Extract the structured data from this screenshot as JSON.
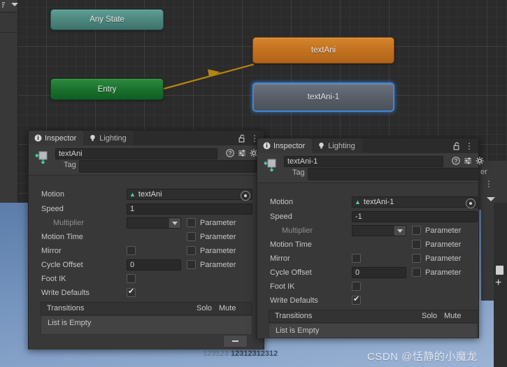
{
  "app": {
    "name": "Unity Editor",
    "context": "Animator window with two Inspector panels"
  },
  "graph": {
    "nodes": [
      {
        "label": "Any State",
        "type": "any-state",
        "color": "#4b857c"
      },
      {
        "label": "Entry",
        "type": "entry",
        "color": "#19702c"
      },
      {
        "label": "textAni",
        "type": "state-default",
        "color": "#c2711f"
      },
      {
        "label": "textAni-1",
        "type": "state-selected",
        "color": "#585f6a",
        "selection_color": "#3f86d8"
      }
    ],
    "transitions": [
      {
        "from": "Entry",
        "to": "textAni",
        "color": "#b5860f"
      }
    ]
  },
  "background_panel": {
    "tab_label_clipped": "oller",
    "kebab": "⋮"
  },
  "desktop": {
    "faint_text": "123123",
    "text": "12312312312",
    "watermark": "CSDN @恬静的小魔龙"
  },
  "inspector_left": {
    "tabs": [
      {
        "label": "Inspector",
        "icon": "info-icon",
        "active": true
      },
      {
        "label": "Lighting",
        "icon": "lightbulb-icon",
        "active": false
      }
    ],
    "lock_icon": "lock-open-icon",
    "menu_icon": "⋮",
    "object_name": "textAni",
    "tag_label": "Tag",
    "tag_value": "",
    "header_icons": [
      "help-icon",
      "preset-icon",
      "gear-icon"
    ],
    "fields": {
      "motion_label": "Motion",
      "motion_value": "textAni",
      "speed_label": "Speed",
      "speed_value": "1",
      "multiplier_label": "Multiplier",
      "multiplier_value": "",
      "multiplier_parameter_label": "Parameter",
      "motion_time_label": "Motion Time",
      "motion_time_parameter_label": "Parameter",
      "mirror_label": "Mirror",
      "mirror_parameter_label": "Parameter",
      "cycle_offset_label": "Cycle Offset",
      "cycle_offset_value": "0",
      "cycle_offset_parameter_label": "Parameter",
      "foot_ik_label": "Foot IK",
      "write_defaults_label": "Write Defaults",
      "write_defaults_checked": true
    },
    "transitions": {
      "title": "Transitions",
      "solo_label": "Solo",
      "mute_label": "Mute",
      "empty_text": "List is Empty",
      "remove_button": "−"
    }
  },
  "inspector_right": {
    "tabs": [
      {
        "label": "Inspector",
        "icon": "info-icon",
        "active": true
      },
      {
        "label": "Lighting",
        "icon": "lightbulb-icon",
        "active": false
      }
    ],
    "lock_icon": "lock-open-icon",
    "menu_icon": "⋮",
    "object_name": "textAni-1",
    "tag_label": "Tag",
    "tag_value": "",
    "header_icons": [
      "help-icon",
      "preset-icon",
      "gear-icon"
    ],
    "fields": {
      "motion_label": "Motion",
      "motion_value": "textAni-1",
      "speed_label": "Speed",
      "speed_value": "-1",
      "multiplier_label": "Multiplier",
      "multiplier_value": "",
      "multiplier_parameter_label": "Parameter",
      "motion_time_label": "Motion Time",
      "motion_time_parameter_label": "Parameter",
      "mirror_label": "Mirror",
      "mirror_parameter_label": "Parameter",
      "cycle_offset_label": "Cycle Offset",
      "cycle_offset_value": "0",
      "cycle_offset_parameter_label": "Parameter",
      "foot_ik_label": "Foot IK",
      "write_defaults_label": "Write Defaults",
      "write_defaults_checked": true
    },
    "transitions": {
      "title": "Transitions",
      "solo_label": "Solo",
      "mute_label": "Mute",
      "empty_text": "List is Empty"
    }
  }
}
